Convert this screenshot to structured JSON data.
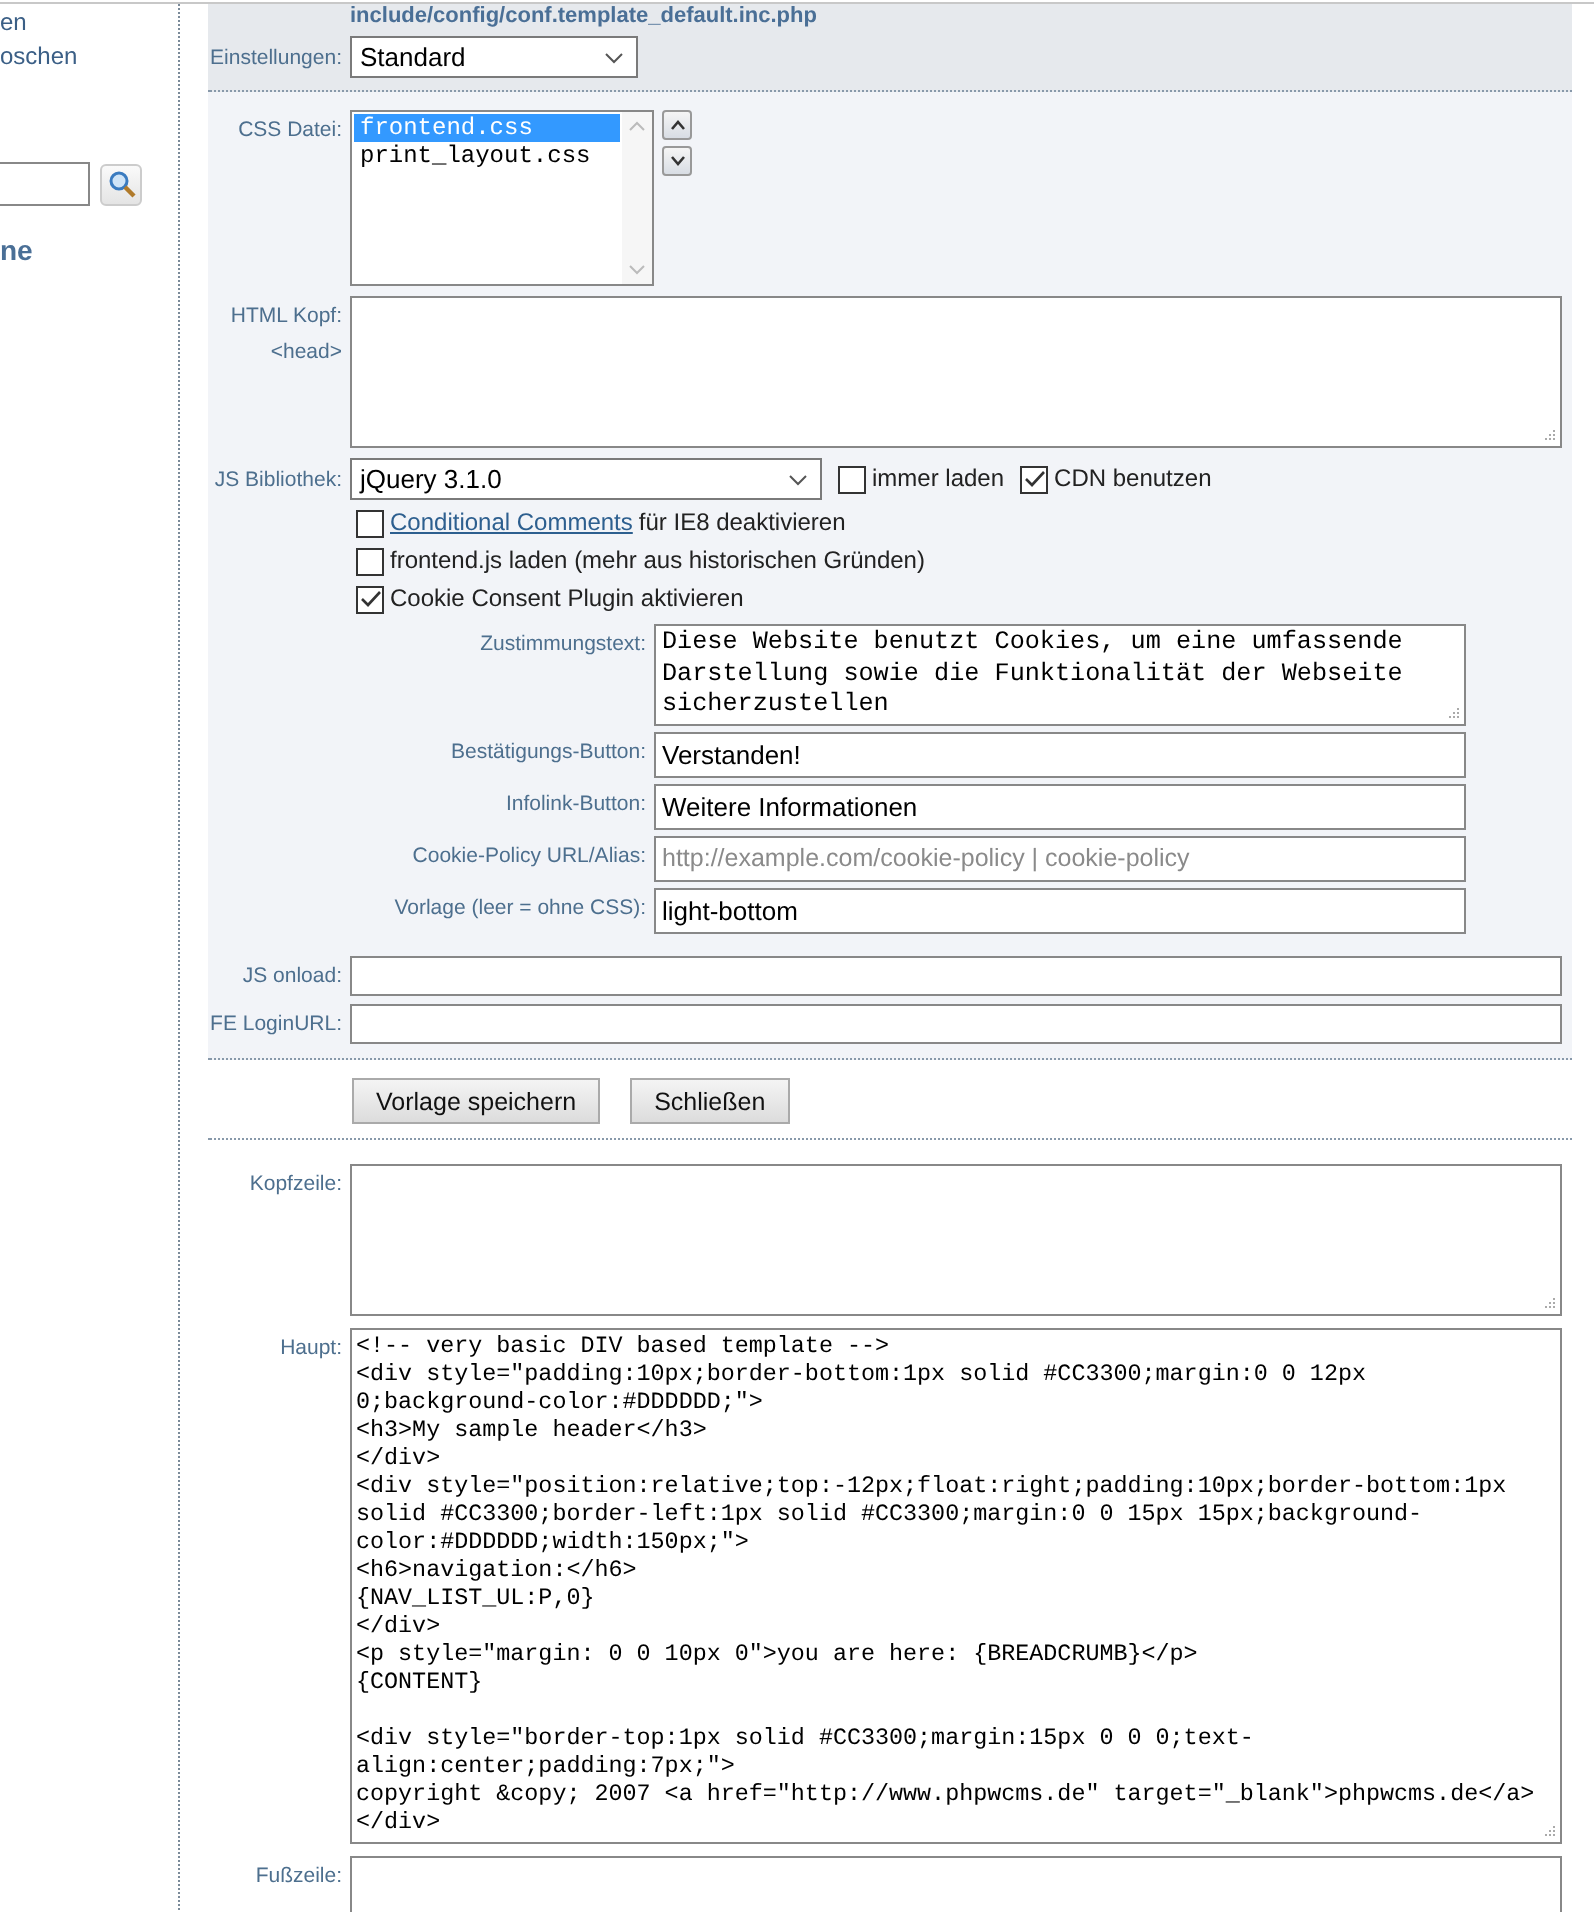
{
  "sidebar": {
    "items": [
      {
        "label": "en"
      },
      {
        "label": "oschen"
      }
    ],
    "heading": "ne"
  },
  "config_path": "include/config/conf.template_default.inc.php",
  "settings": {
    "label": "Einstellungen:",
    "value": "Standard"
  },
  "css_file": {
    "label": "CSS Datei:",
    "options": [
      {
        "label": "frontend.css",
        "selected": true
      },
      {
        "label": "print_layout.css",
        "selected": false
      }
    ]
  },
  "html_head": {
    "label": "HTML Kopf:",
    "sublabel": "<head>"
  },
  "js_library": {
    "label": "JS Bibliothek:",
    "value": "jQuery 3.1.0",
    "options": [
      {
        "label": "immer laden",
        "checked": false
      },
      {
        "label": "CDN benutzen",
        "checked": true
      }
    ]
  },
  "checkboxes": [
    {
      "link": "Conditional Comments",
      "text": "für IE8 deaktivieren",
      "checked": false
    },
    {
      "text": "frontend.js laden (mehr aus historischen Gründen)",
      "checked": false
    },
    {
      "text": "Cookie Consent Plugin aktivieren",
      "checked": true
    }
  ],
  "cookie_fields": [
    {
      "label": "Zustimmungstext:",
      "kind": "textarea",
      "value": "Diese Website benutzt Cookies, um eine umfassende Darstellung sowie die Funktionalität der Webseite sicherzustellen"
    },
    {
      "label": "Bestätigungs-Button:",
      "kind": "input",
      "value": "Verstanden!"
    },
    {
      "label": "Infolink-Button:",
      "kind": "input",
      "value": "Weitere Informationen"
    },
    {
      "label": "Cookie-Policy URL/Alias:",
      "kind": "input",
      "placeholder": "http://example.com/cookie-policy | cookie-policy"
    },
    {
      "label": "Vorlage (leer = ohne CSS):",
      "kind": "input",
      "value": "light-bottom"
    }
  ],
  "extra_fields": [
    {
      "label": "JS onload:"
    },
    {
      "label": "FE LoginURL:"
    }
  ],
  "buttons": [
    "Vorlage speichern",
    "Schließen"
  ],
  "template_fields": [
    {
      "label": "Kopfzeile:",
      "kind": "short"
    },
    {
      "label": "Haupt:",
      "kind": "tall",
      "value": "<!-- very basic DIV based template -->\n<div style=\"padding:10px;border-bottom:1px solid #CC3300;margin:0 0 12px 0;background-color:#DDDDDD;\">\n<h3>My sample header</h3>\n</div>\n<div style=\"position:relative;top:-12px;float:right;padding:10px;border-bottom:1px solid #CC3300;border-left:1px solid #CC3300;margin:0 0 15px 15px;background-color:#DDDDDD;width:150px;\">\n<h6>navigation:</h6>\n{NAV_LIST_UL:P,0}\n</div>\n<p style=\"margin: 0 0 10px 0\">you are here: {BREADCRUMB}</p>\n{CONTENT}\n\n<div style=\"border-top:1px solid #CC3300;margin:15px 0 0 0;text-align:center;padding:7px;\">\ncopyright &copy; 2007 <a href=\"http://www.phpwcms.de\" target=\"_blank\">phpwcms.de</a>\n</div>"
    },
    {
      "label": "Fußzeile:",
      "kind": "short"
    }
  ]
}
